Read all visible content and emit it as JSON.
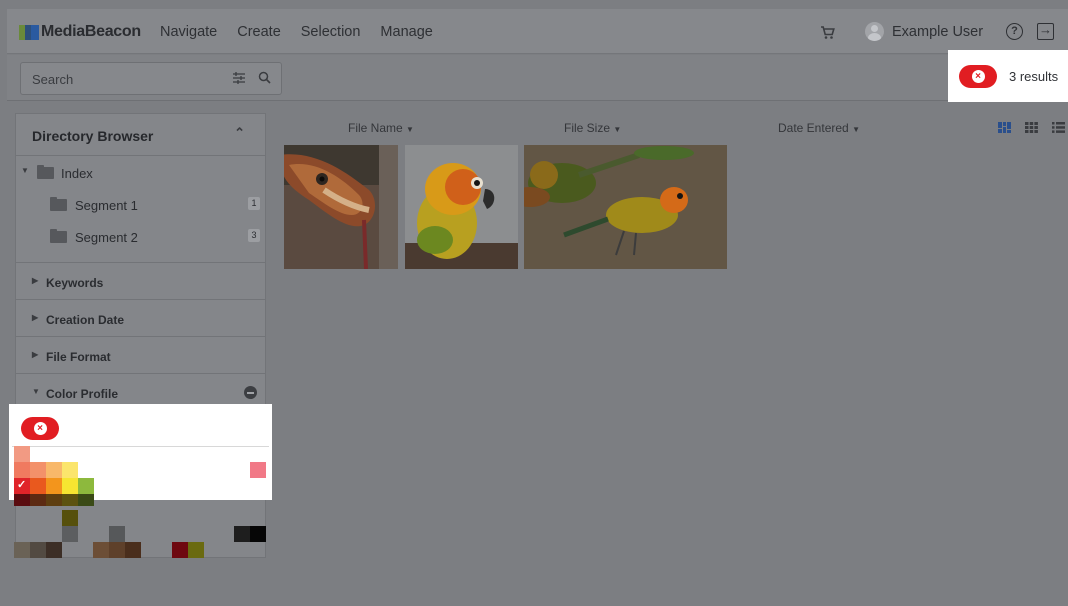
{
  "header": {
    "brand": "MediaBeacon",
    "nav": [
      "Navigate",
      "Create",
      "Selection",
      "Manage"
    ],
    "user_name": "Example User",
    "help_glyph": "?"
  },
  "subbar": {
    "search_placeholder": "Search",
    "results_text": "3 results"
  },
  "sidebar": {
    "title": "Directory Browser",
    "tree": {
      "root": "Index",
      "children": [
        {
          "label": "Segment 1",
          "count": "1"
        },
        {
          "label": "Segment 2",
          "count": "3"
        }
      ]
    },
    "facets": [
      "Keywords",
      "Creation Date",
      "File Format",
      "Color Profile"
    ]
  },
  "columns": {
    "file_name": "File Name",
    "file_size": "File Size",
    "date_entered": "Date Entered"
  },
  "icons": {
    "cart": "shopping-cart-icon",
    "help": "help-circle-icon",
    "logout": "logout-icon",
    "filter": "filter-sliders-icon",
    "search": "search-icon",
    "clear": "clear-filter-icon"
  },
  "colors": {
    "accent_red": "#e11d22",
    "overlay": "#7c7e82",
    "brand_blue": "#1f6fd1"
  },
  "thumbnails": [
    {
      "subject": "snake"
    },
    {
      "subject": "parrot"
    },
    {
      "subject": "parrots-on-ground"
    }
  ]
}
